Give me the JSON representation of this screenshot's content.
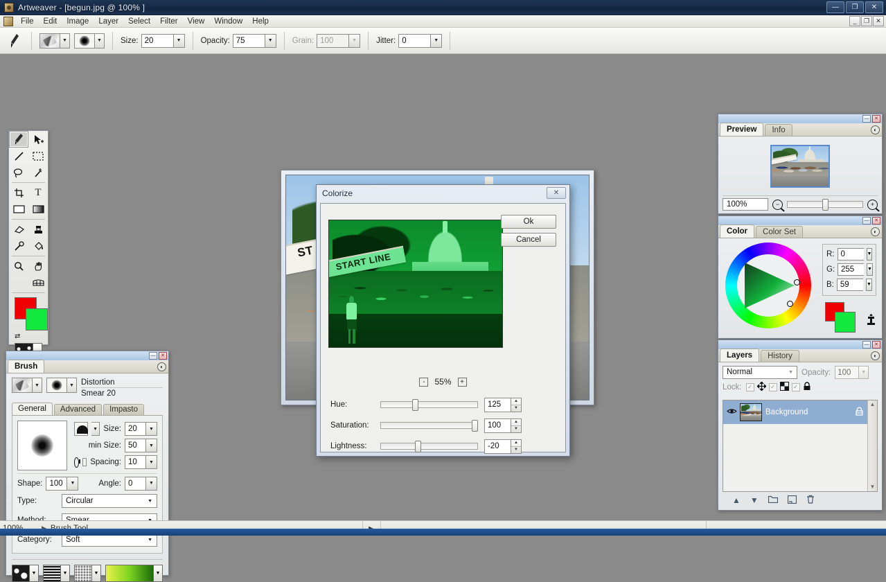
{
  "window": {
    "title": "Artweaver - [begun.jpg @ 100% ]",
    "app_icon": "artweaver-icon",
    "minimize": "—",
    "maximize": "❐",
    "close": "✕",
    "doc_minimize": "_",
    "doc_restore": "❐",
    "doc_close": "✕"
  },
  "menubar": {
    "items": [
      "File",
      "Edit",
      "Image",
      "Layer",
      "Select",
      "Filter",
      "View",
      "Window",
      "Help"
    ]
  },
  "optionsbar": {
    "tool_icon": "brush-tool-icon",
    "stroke_preview": "stroke-preview-swatch",
    "tip_preview": "brush-tip-swatch",
    "fields": [
      {
        "label": "Size:",
        "value": "20",
        "disabled": false
      },
      {
        "label": "Opacity:",
        "value": "75",
        "disabled": false
      },
      {
        "label": "Grain:",
        "value": "100",
        "disabled": true
      },
      {
        "label": "Jitter:",
        "value": "0",
        "disabled": false
      }
    ]
  },
  "toolpalette": {
    "tools": [
      {
        "name": "brush-tool",
        "glyph": "🖌",
        "selected": true
      },
      {
        "name": "move-tool",
        "glyph": "➤",
        "selected": false
      },
      {
        "name": "line-tool",
        "glyph": "╱",
        "selected": false
      },
      {
        "name": "rect-select-tool",
        "glyph": "▭",
        "selected": false
      },
      {
        "name": "lasso-tool",
        "glyph": "◯",
        "selected": false
      },
      {
        "name": "magic-wand-tool",
        "glyph": "✳",
        "selected": false
      },
      {
        "name": "crop-tool",
        "glyph": "⌗",
        "selected": false
      },
      {
        "name": "text-tool",
        "glyph": "T",
        "selected": false
      },
      {
        "name": "shape-tool",
        "glyph": "▭",
        "selected": false
      },
      {
        "name": "gradient-tool",
        "glyph": "▥",
        "selected": false
      },
      {
        "name": "eraser-tool",
        "glyph": "▱",
        "selected": false
      },
      {
        "name": "clone-stamp-tool",
        "glyph": "⚒",
        "selected": false
      },
      {
        "name": "eyedropper-tool",
        "glyph": "⚲",
        "selected": false
      },
      {
        "name": "paint-bucket-tool",
        "glyph": "⬤",
        "selected": false
      },
      {
        "name": "zoom-tool",
        "glyph": "⚲",
        "selected": false
      },
      {
        "name": "hand-tool",
        "glyph": "✋",
        "selected": false
      },
      {
        "name": "grid-tool",
        "glyph": "▦",
        "selected": false
      }
    ],
    "foreground_color": "#FF0000",
    "background_color": "#12E840",
    "swap_glyph": "⇄",
    "texture_dropdown": "▼"
  },
  "document_window": {
    "image_name": "begun.jpg",
    "banner_text": "ST"
  },
  "dialog": {
    "title": "Colorize",
    "close_glyph": "✕",
    "ok_label": "Ok",
    "cancel_label": "Cancel",
    "preview_banner_text": "START LINE",
    "zoom": {
      "minus": "-",
      "value": "55%",
      "plus": "+"
    },
    "sliders": [
      {
        "label": "Hue:",
        "value": "125",
        "percent": 35
      },
      {
        "label": "Saturation:",
        "value": "100",
        "percent": 97
      },
      {
        "label": "Lightness:",
        "value": "-20",
        "percent": 38
      }
    ],
    "stepper_up": "▲",
    "stepper_down": "▼"
  },
  "brush_panel": {
    "caption_minimize": "—",
    "caption_close": "✕",
    "tab": "Brush",
    "menu_glyph": "◐",
    "stroke_name": "Distortion",
    "variant_name": "Smear 20",
    "tabs": [
      {
        "label": "General",
        "active": true
      },
      {
        "label": "Advanced",
        "active": false
      },
      {
        "label": "Impasto",
        "active": false
      }
    ],
    "fields": [
      {
        "label": "Size:",
        "value": "20"
      },
      {
        "label": "min Size:",
        "value": "50"
      },
      {
        "label": "Spacing:",
        "value": "10"
      }
    ],
    "shape": {
      "label": "Shape:",
      "value": "100"
    },
    "angle": {
      "label": "Angle:",
      "value": "0"
    },
    "selects": [
      {
        "label": "Type:",
        "value": "Circular"
      },
      {
        "label": "Method:",
        "value": "Smear"
      },
      {
        "label": "Category:",
        "value": "Soft"
      }
    ],
    "dropdown_glyph": "▼"
  },
  "preview_panel": {
    "caption_minimize": "—",
    "caption_close": "✕",
    "tabs": [
      {
        "label": "Preview",
        "active": true
      },
      {
        "label": "Info",
        "active": false
      }
    ],
    "menu_glyph": "◐",
    "zoom_value": "100%",
    "zoom_out_icon": "zoom-out-icon",
    "zoom_in_icon": "zoom-in-icon"
  },
  "color_panel": {
    "caption_minimize": "—",
    "caption_close": "✕",
    "tabs": [
      {
        "label": "Color",
        "active": true
      },
      {
        "label": "Color Set",
        "active": false
      }
    ],
    "menu_glyph": "◐",
    "channels": [
      {
        "label": "R:",
        "value": "0"
      },
      {
        "label": "G:",
        "value": "255"
      },
      {
        "label": "B:",
        "value": "59"
      }
    ],
    "foreground_color": "#FF0000",
    "background_color": "#12E840",
    "current_color": "#00FF3B",
    "dropdown_glyph": "▼",
    "picker_icon": "color-picker-icon"
  },
  "layers_panel": {
    "caption_minimize": "—",
    "caption_close": "✕",
    "tabs": [
      {
        "label": "Layers",
        "active": true
      },
      {
        "label": "History",
        "active": false
      }
    ],
    "menu_glyph": "◐",
    "blend_mode": "Normal",
    "opacity_label": "Opacity:",
    "opacity_value": "100",
    "lock_label": "Lock:",
    "lock_toggles": [
      {
        "name": "lock-transparency",
        "checked": "✓",
        "icon": "move-icon"
      },
      {
        "name": "lock-pixels",
        "checked": "✓",
        "icon": "pixels-icon"
      },
      {
        "name": "lock-all",
        "checked": "✓",
        "icon": "lock-icon"
      }
    ],
    "layers": [
      {
        "name": "Background",
        "visible": true,
        "locked": true,
        "selected": true
      }
    ],
    "footer_buttons": [
      {
        "name": "move-layer-up-button",
        "glyph": "▲"
      },
      {
        "name": "move-layer-down-button",
        "glyph": "▼"
      },
      {
        "name": "new-group-button",
        "glyph": "🗀"
      },
      {
        "name": "new-layer-button",
        "glyph": "❐"
      },
      {
        "name": "delete-layer-button",
        "glyph": "🗑"
      }
    ],
    "scroll_up": "▲",
    "scroll_down": "▼",
    "eye_icon": "eye-icon",
    "lock_mini_icon": "lock-icon"
  },
  "statusbar": {
    "zoom": "100%",
    "arrow": "▶",
    "tool_name": "Brush Tool",
    "section_arrow": "▶"
  }
}
